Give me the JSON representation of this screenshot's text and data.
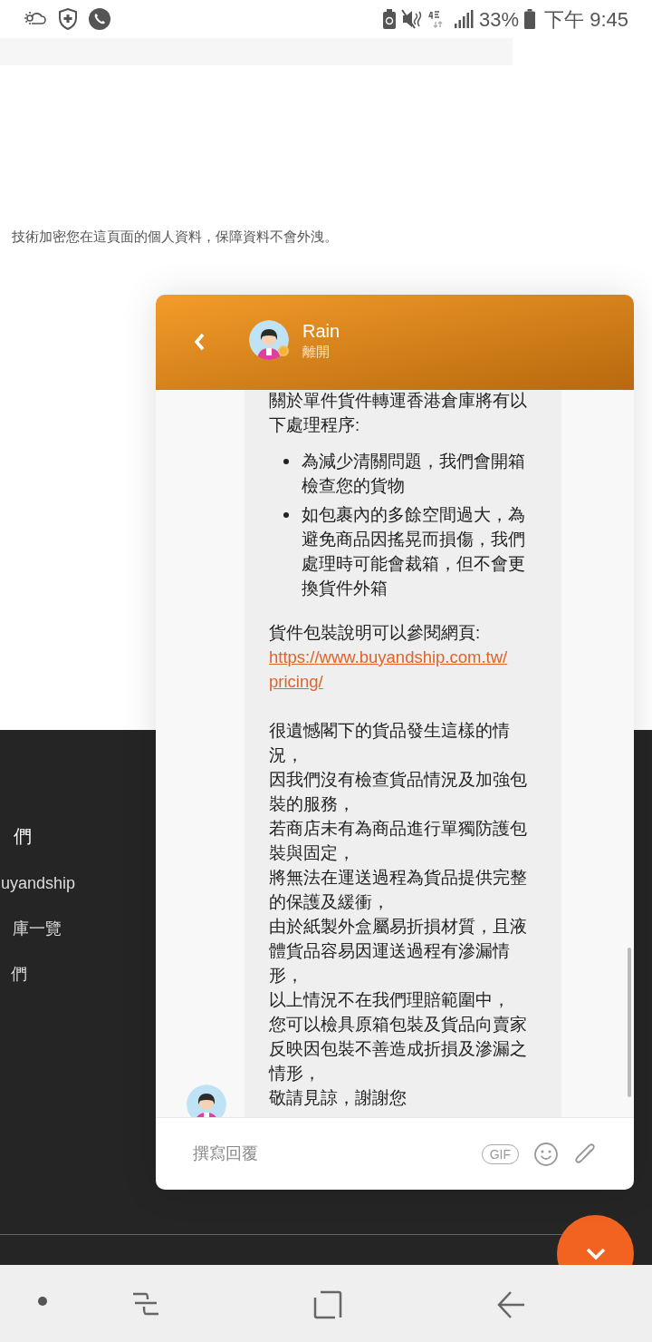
{
  "status_bar": {
    "battery": "33%",
    "time": "下午 9:45"
  },
  "page": {
    "notice": "技術加密您在這頁面的個人資料，保障資料不會外洩。",
    "footer": {
      "heading": "們",
      "links": [
        "uyandship",
        "庫一覽",
        "們"
      ]
    }
  },
  "chat": {
    "agent": {
      "name": "Rain",
      "status": "離開"
    },
    "message": [
      {
        "kind": "text",
        "text": "關於單件貨件轉運香港倉庫將有以下處理程序:"
      },
      {
        "kind": "bullets",
        "items": [
          "為減少清關問題，我們會開箱檢查您的貨物",
          "如包裹內的多餘空間過大，為避免商品因搖晃而損傷，我們處理時可能會裁箱，但不會更換貨件外箱"
        ]
      },
      {
        "kind": "text",
        "text": "貨件包裝說明可以參閱網頁:"
      },
      {
        "kind": "link",
        "text": "https://www.buyandship.com.tw/pricing/"
      },
      {
        "kind": "gap"
      },
      {
        "kind": "text",
        "text": "很遺憾閣下的貨品發生這樣的情況，"
      },
      {
        "kind": "text",
        "text": "因我們沒有檢查貨品情況及加強包裝的服務，"
      },
      {
        "kind": "text",
        "text": "若商店未有為商品進行單獨防護包裝與固定，"
      },
      {
        "kind": "text",
        "text": "將無法在運送過程為貨品提供完整的保護及緩衝，"
      },
      {
        "kind": "text",
        "text": "由於紙製外盒屬易折損材質，且液體貨品容易因運送過程有滲漏情形，"
      },
      {
        "kind": "text",
        "text": "以上情況不在我們理賠範圍中，"
      },
      {
        "kind": "text",
        "text": "您可以檢具原箱包裝及貨品向賣家反映因包裝不善造成折損及滲漏之情形，"
      },
      {
        "kind": "text",
        "text": "敬請見諒，謝謝您"
      }
    ],
    "composer": {
      "placeholder": "撰寫回覆",
      "gif": "GIF"
    }
  }
}
